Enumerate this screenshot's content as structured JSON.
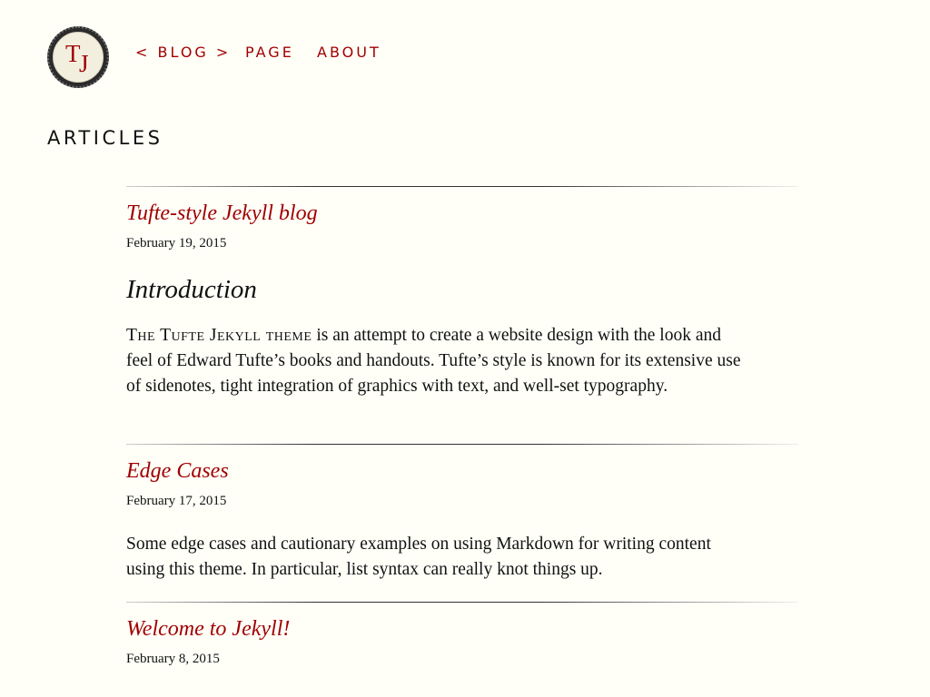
{
  "logo": {
    "letter_t": "T",
    "letter_j": "J",
    "accent_color": "#a00000"
  },
  "nav": {
    "blog_label": "< BLOG >",
    "page_label": "PAGE",
    "about_label": "ABOUT"
  },
  "page_heading": "ARTICLES",
  "posts": [
    {
      "title": "Tufte-style Jekyll blog",
      "date": "February 19, 2015",
      "subheading": "Introduction",
      "excerpt_smallcaps": "The Tufte Jekyll theme",
      "excerpt": " is an attempt to create a website design with the look and feel of Edward Tufte’s books and handouts. Tufte’s style is known for its extensive use of sidenotes, tight integration of graphics with text, and well-set typography."
    },
    {
      "title": "Edge Cases",
      "date": "February 17, 2015",
      "excerpt": "Some edge cases and cautionary examples on using Markdown for writing content using this theme. In particular, list syntax can really knot things up."
    },
    {
      "title": "Welcome to Jekyll!",
      "date": "February 8, 2015"
    }
  ]
}
